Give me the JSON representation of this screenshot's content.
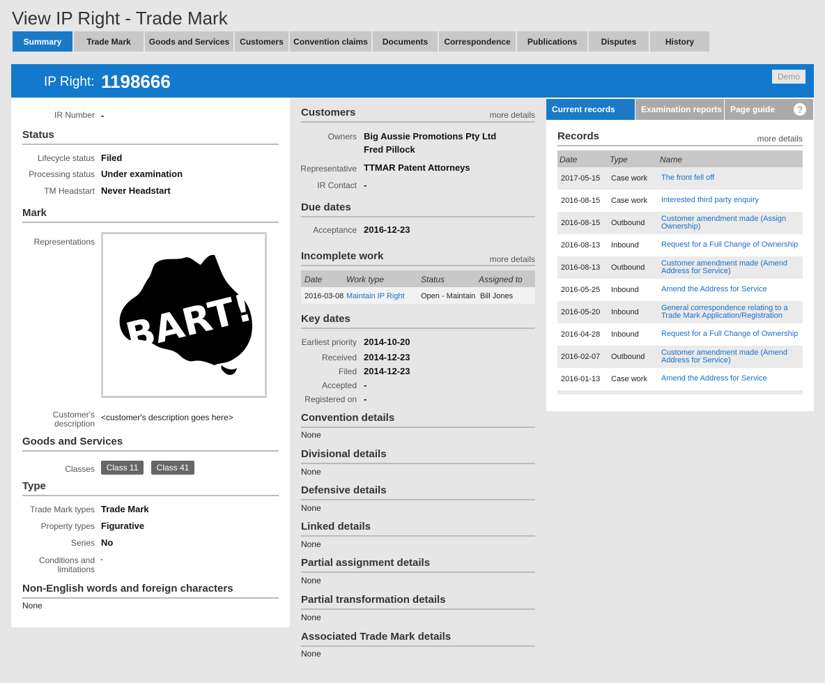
{
  "page": {
    "title": "View IP Right - Trade Mark"
  },
  "tabs": [
    "Summary",
    "Trade Mark",
    "Goods and Services",
    "Customers",
    "Convention claims",
    "Documents",
    "Correspondence",
    "Publications",
    "Disputes",
    "History"
  ],
  "header": {
    "label": "IP Right:",
    "number": "1198666",
    "demo": "Demo"
  },
  "left": {
    "ir_number_label": "IR Number",
    "ir_number": "-",
    "status_title": "Status",
    "lifecycle_label": "Lifecycle status",
    "lifecycle": "Filed",
    "processing_label": "Processing status",
    "processing": "Under examination",
    "headstart_label": "TM Headstart",
    "headstart": "Never Headstart",
    "mark_title": "Mark",
    "representations_label": "Representations",
    "mark_text": "BART!",
    "cust_desc_label_1": "Customer's",
    "cust_desc_label_2": "description",
    "cust_desc": "<customer's description goes here>",
    "gs_title": "Goods and Services",
    "classes_label": "Classes",
    "class1": "Class 11",
    "class2": "Class 41",
    "type_title": "Type",
    "tm_types_label": "Trade Mark types",
    "tm_types": "Trade Mark",
    "prop_types_label": "Property types",
    "prop_types": "Figurative",
    "series_label": "Series",
    "series": "No",
    "cond_label_1": "Conditions and",
    "cond_label_2": "limitations",
    "cond": "-",
    "nonenglish_title": "Non-English words and foreign characters",
    "nonenglish": "None"
  },
  "mid": {
    "customers_title": "Customers",
    "more": "more details",
    "owners_label": "Owners",
    "owner1": "Big Aussie Promotions Pty Ltd",
    "owner2": "Fred Pillock",
    "rep_label": "Representative",
    "rep": "TTMAR Patent Attorneys",
    "ircontact_label": "IR Contact",
    "ircontact": "-",
    "due_title": "Due dates",
    "acceptance_label": "Acceptance",
    "acceptance": "2016-12-23",
    "incomplete_title": "Incomplete work",
    "iw_headers": [
      "Date",
      "Work type",
      "Status",
      "Assigned to"
    ],
    "iw_row": [
      "2016-03-08",
      "Maintain IP Right",
      "Open - Maintain",
      "Bill Jones"
    ],
    "key_title": "Key dates",
    "earliest_label": "Earliest priority",
    "earliest": "2014-10-20",
    "received_label": "Received",
    "received": "2014-12-23",
    "filed_label": "Filed",
    "filed": "2014-12-23",
    "accepted_label": "Accepted",
    "accepted": "-",
    "registered_label": "Registered on",
    "registered": "-",
    "conv_title": "Convention details",
    "div_title": "Divisional details",
    "def_title": "Defensive details",
    "linked_title": "Linked details",
    "partial_assign_title": "Partial assignment details",
    "partial_trans_title": "Partial transformation details",
    "assoc_title": "Associated Trade Mark details",
    "none": "None"
  },
  "right": {
    "tabs": [
      "Current records",
      "Examination reports",
      "Page guide"
    ],
    "help": "?",
    "records_title": "Records",
    "more": "more details",
    "headers": [
      "Date",
      "Type",
      "Name"
    ],
    "rows": [
      {
        "date": "2017-05-15",
        "type": "Case work",
        "name": "The front fell off"
      },
      {
        "date": "2016-08-15",
        "type": "Case work",
        "name": "Interested third party enquiry"
      },
      {
        "date": "2016-08-15",
        "type": "Outbound",
        "name": "Customer amendment made (Assign Ownership)"
      },
      {
        "date": "2016-08-13",
        "type": "Inbound",
        "name": "Request for a Full Change of Ownership"
      },
      {
        "date": "2016-08-13",
        "type": "Outbound",
        "name": "Customer amendment made (Amend Address for Service)"
      },
      {
        "date": "2016-05-25",
        "type": "Inbound",
        "name": "Amend the Address for Service"
      },
      {
        "date": "2016-05-20",
        "type": "Inbound",
        "name": "General correspondence relating to a Trade Mark Application/Registration"
      },
      {
        "date": "2016-04-28",
        "type": "Inbound",
        "name": "Request for a Full Change of Ownership"
      },
      {
        "date": "2016-02-07",
        "type": "Outbound",
        "name": "Customer amendment made (Amend Address for Service)"
      },
      {
        "date": "2016-01-13",
        "type": "Case work",
        "name": "Amend the Address for Service"
      }
    ]
  }
}
